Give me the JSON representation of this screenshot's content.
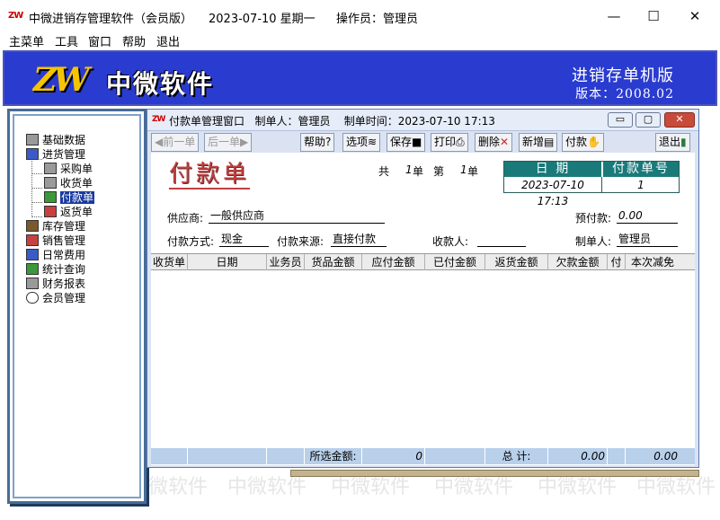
{
  "titlebar": {
    "app_title": "中微进销存管理软件（会员版）",
    "date": "2023-07-10  星期一",
    "operator": "操作员：管理员",
    "logo_text": "ZW",
    "minimize": "—",
    "maximize": "☐",
    "close": "✕"
  },
  "menu": {
    "items": [
      "主菜单",
      "工具",
      "窗口",
      "帮助",
      "退出"
    ]
  },
  "banner": {
    "logo_text": "ZW",
    "company": "中微软件",
    "edition": "进销存单机版",
    "version": "版本：2008.02"
  },
  "watermark": "中微软件",
  "tree": {
    "items": [
      {
        "label": "基础数据"
      },
      {
        "label": "进货管理"
      },
      {
        "label": "采购单"
      },
      {
        "label": "收货单"
      },
      {
        "label": "付款单"
      },
      {
        "label": "返货单"
      },
      {
        "label": "库存管理"
      },
      {
        "label": "销售管理"
      },
      {
        "label": "日常费用"
      },
      {
        "label": "统计查询"
      },
      {
        "label": "财务报表"
      },
      {
        "label": "会员管理"
      }
    ]
  },
  "child": {
    "logo_text": "ZW",
    "title": "付款单管理窗口",
    "creator": "制单人：管理员",
    "create_time": "制单时间：2023-07-10 17:13",
    "toolbar": {
      "prev": "前一单",
      "next": "后一单",
      "help": "帮助",
      "options": "选项",
      "save": "保存",
      "print": "打印",
      "delete": "删除",
      "add": "新增",
      "pay": "付款",
      "exit": "退出"
    },
    "form": {
      "doc_title": "付款单",
      "total_label": "共",
      "total_count": "1",
      "unit1": "单",
      "page_label": "第",
      "page_num": "1",
      "unit2": "单",
      "date_header": "日  期",
      "no_header": "付款单号",
      "date_value": "2023-07-10 17:13",
      "no_value": "1",
      "supplier_label": "供应商:",
      "supplier_value": "一般供应商",
      "prepay_label": "预付款:",
      "prepay_value": "0.00",
      "paymethod_label": "付款方式:",
      "paymethod_value": "现金",
      "paysource_label": "付款来源:",
      "paysource_value": "直接付款",
      "payee_label": "收款人:",
      "payee_value": "",
      "maker_label": "制单人:",
      "maker_value": "管理员"
    },
    "grid": {
      "columns": [
        "收货单",
        "日期",
        "业务员",
        "货品金额",
        "应付金额",
        "已付金额",
        "返货金额",
        "欠款金额",
        "付",
        "本次减免"
      ],
      "footer": {
        "selected_label": "所选金额:",
        "selected_value": "0",
        "total_label": "总  计:",
        "total_value1": "0.00",
        "total_value2": "0.00"
      }
    }
  }
}
